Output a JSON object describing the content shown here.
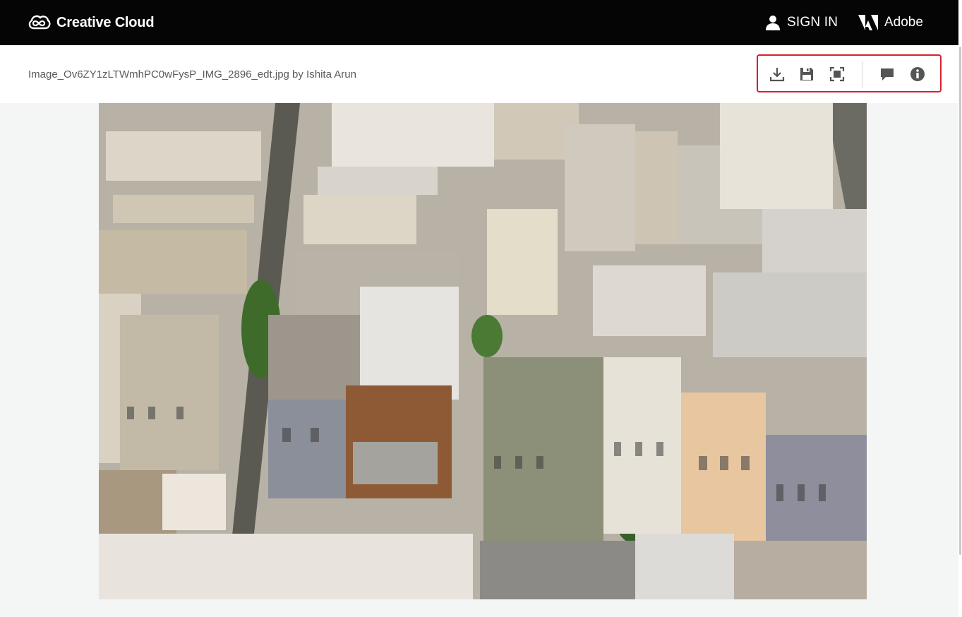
{
  "topbar": {
    "brand_label": "Creative Cloud",
    "signin_label": "SIGN IN",
    "adobe_label": "Adobe",
    "background": "#050505"
  },
  "header": {
    "file_title": "Image_Ov6ZY1zLTWmhPC0wFysP_IMG_2896_edt.jpg by Ishita Arun"
  },
  "toolbar": {
    "highlight_color": "#d9202e",
    "icons": [
      "download-icon",
      "save-icon",
      "fit-screen-icon",
      "comment-icon",
      "info-icon"
    ]
  },
  "photo": {
    "subject": "aerial-city-rooftops-image"
  }
}
